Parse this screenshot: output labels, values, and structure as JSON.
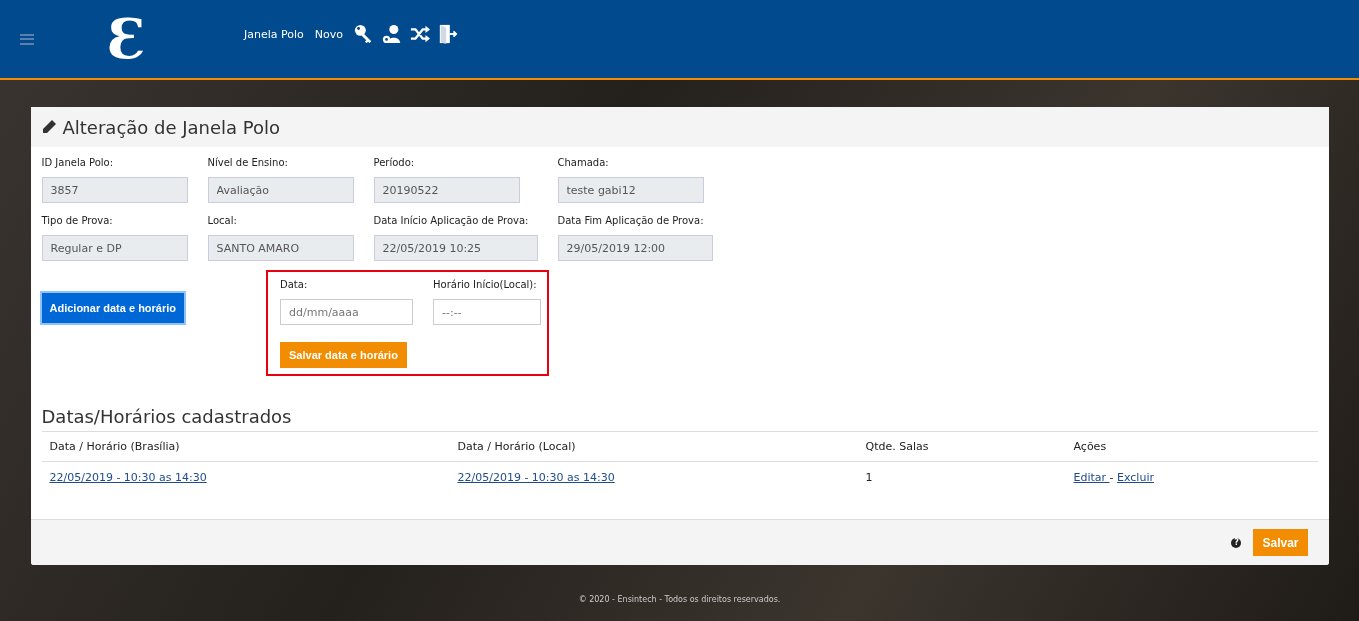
{
  "header": {
    "logo": "Ɛ",
    "nav": [
      "Janela Polo",
      "Novo"
    ]
  },
  "card": {
    "title": "Alteração de Janela Polo",
    "fields": [
      {
        "label": "ID Janela Polo:",
        "value": "3857"
      },
      {
        "label": "Nível de Ensino:",
        "value": "Avaliação"
      },
      {
        "label": "Período:",
        "value": "20190522"
      },
      {
        "label": "Chamada:",
        "value": "teste gabi12"
      },
      {
        "label": "Tipo de Prova:",
        "value": "Regular e DP"
      },
      {
        "label": "Local:",
        "value": "SANTO AMARO"
      },
      {
        "label": "Data Início Aplicação de Prova:",
        "value": "22/05/2019 10:25"
      },
      {
        "label": "Data Fim Aplicação de Prova:",
        "value": "29/05/2019 12:00"
      }
    ],
    "add_button": "Adicionar data e horário",
    "schedule_form": {
      "date_label": "Data:",
      "date_placeholder": "dd/mm/aaaa",
      "time_label": "Horário Início(Local):",
      "time_placeholder": "--:--",
      "save_button": "Salvar data e horário"
    },
    "table": {
      "title": "Datas/Horários cadastrados",
      "columns": [
        "Data / Horário (Brasília)",
        "Data / Horário (Local)",
        "Qtde. Salas",
        "Ações"
      ],
      "rows": [
        {
          "brasilia": "22/05/2019 - 10:30 as 14:30",
          "local": "22/05/2019 - 10:30 as 14:30",
          "rooms": "1",
          "edit": "Editar ",
          "separator": "-",
          "delete": "Excluir"
        }
      ]
    },
    "help_icon": "?",
    "save_button": "Salvar"
  },
  "footer": "© 2020 - Ensintech - Todos os direitos reservados."
}
